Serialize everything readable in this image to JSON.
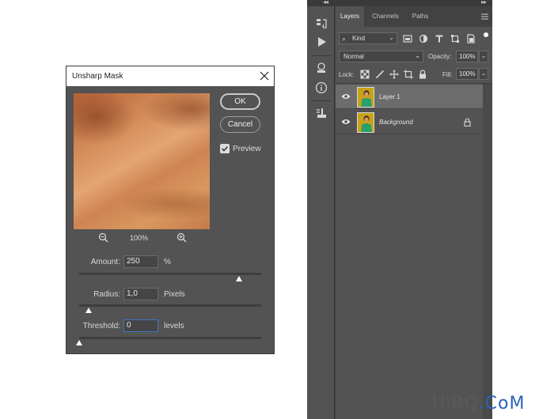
{
  "dialog": {
    "title": "Unsharp Mask",
    "ok_label": "OK",
    "cancel_label": "Cancel",
    "preview_label": "Preview",
    "preview_checked": true,
    "zoom_level": "100%",
    "amount": {
      "label": "Amount:",
      "value": "250",
      "unit": "%",
      "slider_fraction": 0.88
    },
    "radius": {
      "label": "Radius:",
      "value": "1,0",
      "unit": "Pixels",
      "slider_fraction": 0.05
    },
    "threshold": {
      "label": "Threshold:",
      "value": "0",
      "unit": "levels",
      "slider_fraction": 0.0
    }
  },
  "layers_panel": {
    "tabs": [
      {
        "label": "Layers",
        "active": true
      },
      {
        "label": "Channels",
        "active": false
      },
      {
        "label": "Paths",
        "active": false
      }
    ],
    "filter_kind": "Kind",
    "blend_mode": "Normal",
    "opacity_label": "Opacity:",
    "opacity_value": "100%",
    "lock_label": "Lock:",
    "fill_label": "Fill:",
    "fill_value": "100%",
    "layers": [
      {
        "name": "Layer 1",
        "selected": true,
        "visible": true,
        "locked": false,
        "italic": false
      },
      {
        "name": "Background",
        "selected": false,
        "visible": true,
        "locked": true,
        "italic": true
      }
    ]
  },
  "watermark": {
    "part1": "UiBQ",
    "part2": ".CoM"
  },
  "colors": {
    "dialog_bg": "#535353",
    "panel_bg": "#535353",
    "selected_layer": "#6c6c6c",
    "active_input_border": "#3b77c2",
    "thumbnail_gold": "#c9a21b",
    "figure_green": "#2aa06c"
  }
}
